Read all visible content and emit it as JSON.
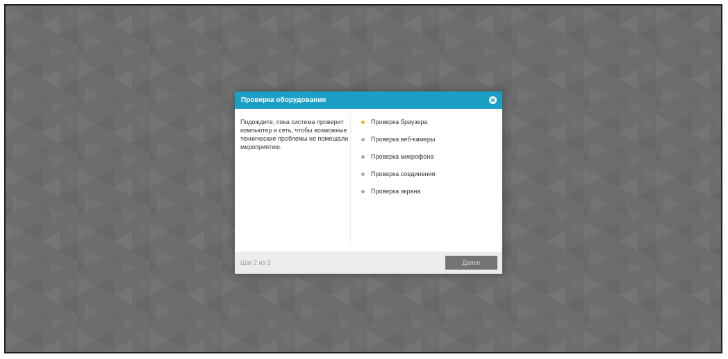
{
  "dialog": {
    "title": "Проверка оборудования",
    "description": "Подождите, пока система проверит компьютер и сеть, чтобы возможные технические проблемы не помешали мероприятию.",
    "checks": [
      {
        "label": "Проверка браузера",
        "status_color": "#f5a623"
      },
      {
        "label": "Проверка веб-камеры",
        "status_color": "#a8a8a8"
      },
      {
        "label": "Проверка микрофона",
        "status_color": "#a8a8a8"
      },
      {
        "label": "Проверка соединения",
        "status_color": "#a8a8a8"
      },
      {
        "label": "Проверка экрана",
        "status_color": "#a8a8a8"
      }
    ],
    "step_counter": "Шаг 2 из 3",
    "next_label": "Далее",
    "close_icon": "close-icon"
  },
  "colors": {
    "header": "#1c9fc4",
    "backdrop": "#6b6b6b",
    "active_status": "#f5a623",
    "pending_status": "#a8a8a8"
  }
}
